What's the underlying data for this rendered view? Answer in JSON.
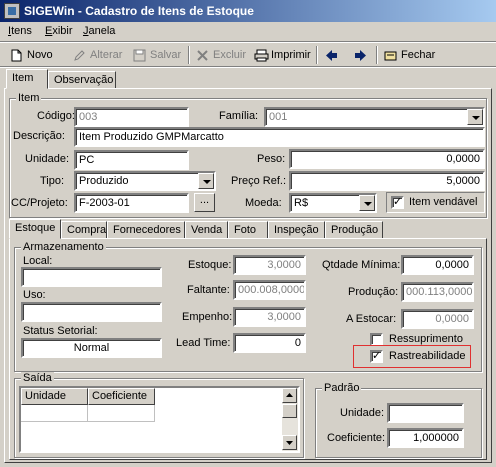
{
  "window": {
    "title": "SIGEWin - Cadastro de Itens de Estoque"
  },
  "menu": [
    "Itens",
    "Exibir",
    "Janela"
  ],
  "toolbar": {
    "novo": "Novo",
    "alterar": "Alterar",
    "salvar": "Salvar",
    "excluir": "Excluir",
    "imprimir": "Imprimir",
    "fechar": "Fechar"
  },
  "main_tabs": [
    "Item",
    "Observação"
  ],
  "item": {
    "group_title": "Item",
    "codigo_label": "Código:",
    "codigo_value": "003",
    "familia_label": "Família:",
    "familia_value": "001",
    "descricao_label": "Descrição:",
    "descricao_value": "Item Produzido GMPMarcatto",
    "unidade_label": "Unidade:",
    "unidade_value": "PC",
    "peso_label": "Peso:",
    "peso_value": "0,0000",
    "tipo_label": "Tipo:",
    "tipo_value": "Produzido",
    "preco_label": "Preço Ref.:",
    "preco_value": "5,0000",
    "cc_label": "CC/Projeto:",
    "cc_value": "F-2003-01",
    "cc_button": "...",
    "moeda_label": "Moeda:",
    "moeda_value": "R$",
    "vendavel_label": "Item vendável"
  },
  "sub_tabs": [
    "Estoque",
    "Compra",
    "Fornecedores",
    "Venda",
    "Foto",
    "Inspeção",
    "Produção"
  ],
  "estoque": {
    "group_title": "Armazenamento",
    "local_label": "Local:",
    "local_value": "",
    "uso_label": "Uso:",
    "uso_value": "",
    "status_label": "Status Setorial:",
    "status_value": "Normal",
    "estoque_label": "Estoque:",
    "estoque_value": "3,0000",
    "faltante_label": "Faltante:",
    "faltante_value": "000.008,0000",
    "empenho_label": "Empenho:",
    "empenho_value": "3,0000",
    "leadtime_label": "Lead Time:",
    "leadtime_value": "0",
    "qtd_min_label": "Qtdade Mínima:",
    "qtd_min_value": "0,0000",
    "producao_label": "Produção:",
    "producao_value": "000.113,0000",
    "a_estocar_label": "A Estocar:",
    "a_estocar_value": "0,0000",
    "ressuprimento_label": "Ressuprimento",
    "rastreabilidade_label": "Rastreabilidade"
  },
  "saida": {
    "group_title": "Saída",
    "columns": [
      "Unidade",
      "Coeficiente"
    ]
  },
  "padrao": {
    "group_title": "Padrão",
    "unidade_label": "Unidade:",
    "unidade_value": "",
    "coeficiente_label": "Coeficiente:",
    "coeficiente_value": "1,000000"
  },
  "colors": {
    "highlight_border": "#e03030",
    "title_start": "#0a246a",
    "title_end": "#a6caf0"
  }
}
